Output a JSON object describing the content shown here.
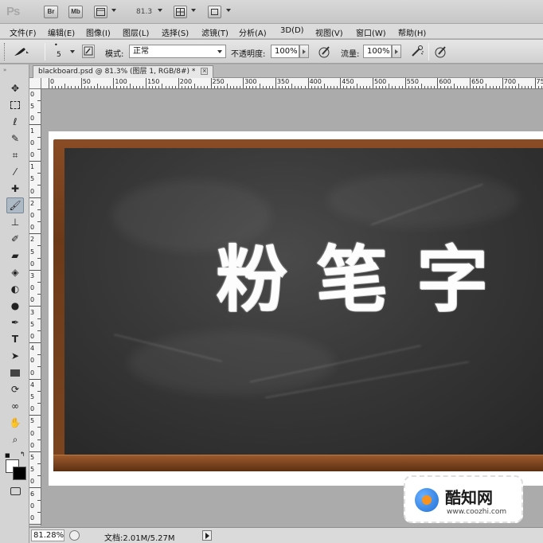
{
  "appbar": {
    "logo": "Ps",
    "bridge": "Br",
    "mini_bridge": "Mb",
    "zoom": "81.3"
  },
  "menu": [
    "文件(F)",
    "编辑(E)",
    "图像(I)",
    "图层(L)",
    "选择(S)",
    "滤镜(T)",
    "分析(A)",
    "3D(D)",
    "视图(V)",
    "窗口(W)",
    "帮助(H)"
  ],
  "options": {
    "brush_size": "5",
    "mode_label": "模式:",
    "mode_value": "正常",
    "opacity_label": "不透明度:",
    "opacity_value": "100%",
    "flow_label": "流量:",
    "flow_value": "100%"
  },
  "document": {
    "tab_title": "blackboard.psd @ 81.3% (图层 1, RGB/8#) *",
    "close_glyph": "×"
  },
  "ruler": {
    "top_labels": [
      "0",
      "50",
      "100",
      "150",
      "200",
      "250",
      "300",
      "350",
      "400",
      "450",
      "500",
      "550",
      "600",
      "650",
      "700",
      "750"
    ],
    "left_labels": [
      "0",
      "5",
      "0",
      "1",
      "0",
      "0",
      "1",
      "5",
      "0",
      "2",
      "0",
      "0",
      "2",
      "5",
      "0",
      "3",
      "0",
      "0",
      "3",
      "5",
      "0",
      "4",
      "0",
      "0",
      "4",
      "5",
      "0",
      "5",
      "0",
      "0",
      "5",
      "5",
      "0",
      "6",
      "0",
      "0"
    ]
  },
  "canvas": {
    "chalk_text": "粉笔字"
  },
  "watermark": {
    "title": "酷知网",
    "url": "www.coozhi.com"
  },
  "status": {
    "zoom": "81.28%",
    "doc_info": "文档:2.01M/5.27M"
  },
  "colors": {
    "frame_wood": "#7c4520",
    "board": "#383838",
    "chalk": "#fdfdfd"
  }
}
